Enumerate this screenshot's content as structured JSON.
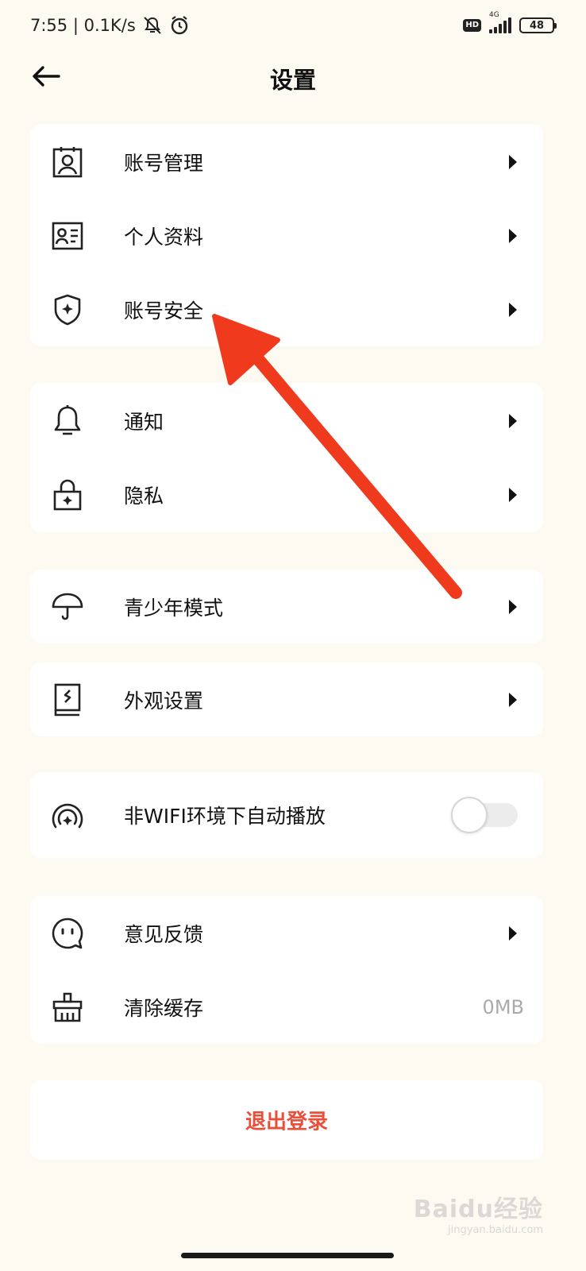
{
  "status_bar": {
    "time": "7:55",
    "speed": "0.1K/s",
    "hd": "HD",
    "network": "4G",
    "battery": "48"
  },
  "header": {
    "title": "设置"
  },
  "sections": {
    "account": [
      {
        "label": "账号管理",
        "icon": "id-badge-icon"
      },
      {
        "label": "个人资料",
        "icon": "profile-card-icon"
      },
      {
        "label": "账号安全",
        "icon": "shield-icon"
      }
    ],
    "alerts": [
      {
        "label": "通知",
        "icon": "bell-icon"
      },
      {
        "label": "隐私",
        "icon": "lock-icon"
      }
    ],
    "youth": {
      "label": "青少年模式",
      "icon": "umbrella-icon"
    },
    "appearance": {
      "label": "外观设置",
      "icon": "book-icon"
    },
    "autoplay": {
      "label": "非WIFI环境下自动播放",
      "icon": "broadcast-icon",
      "enabled": false
    },
    "misc": [
      {
        "label": "意见反馈",
        "icon": "chat-face-icon"
      },
      {
        "label": "清除缓存",
        "icon": "broom-icon",
        "value": "0MB"
      }
    ]
  },
  "logout": {
    "label": "退出登录",
    "color": "#e8503a"
  },
  "watermark": {
    "main": "Baidu经验",
    "sub": "jingyan.baidu.com"
  },
  "colors": {
    "background": "#fdfaf2",
    "annotation_arrow": "#f03a1e"
  }
}
